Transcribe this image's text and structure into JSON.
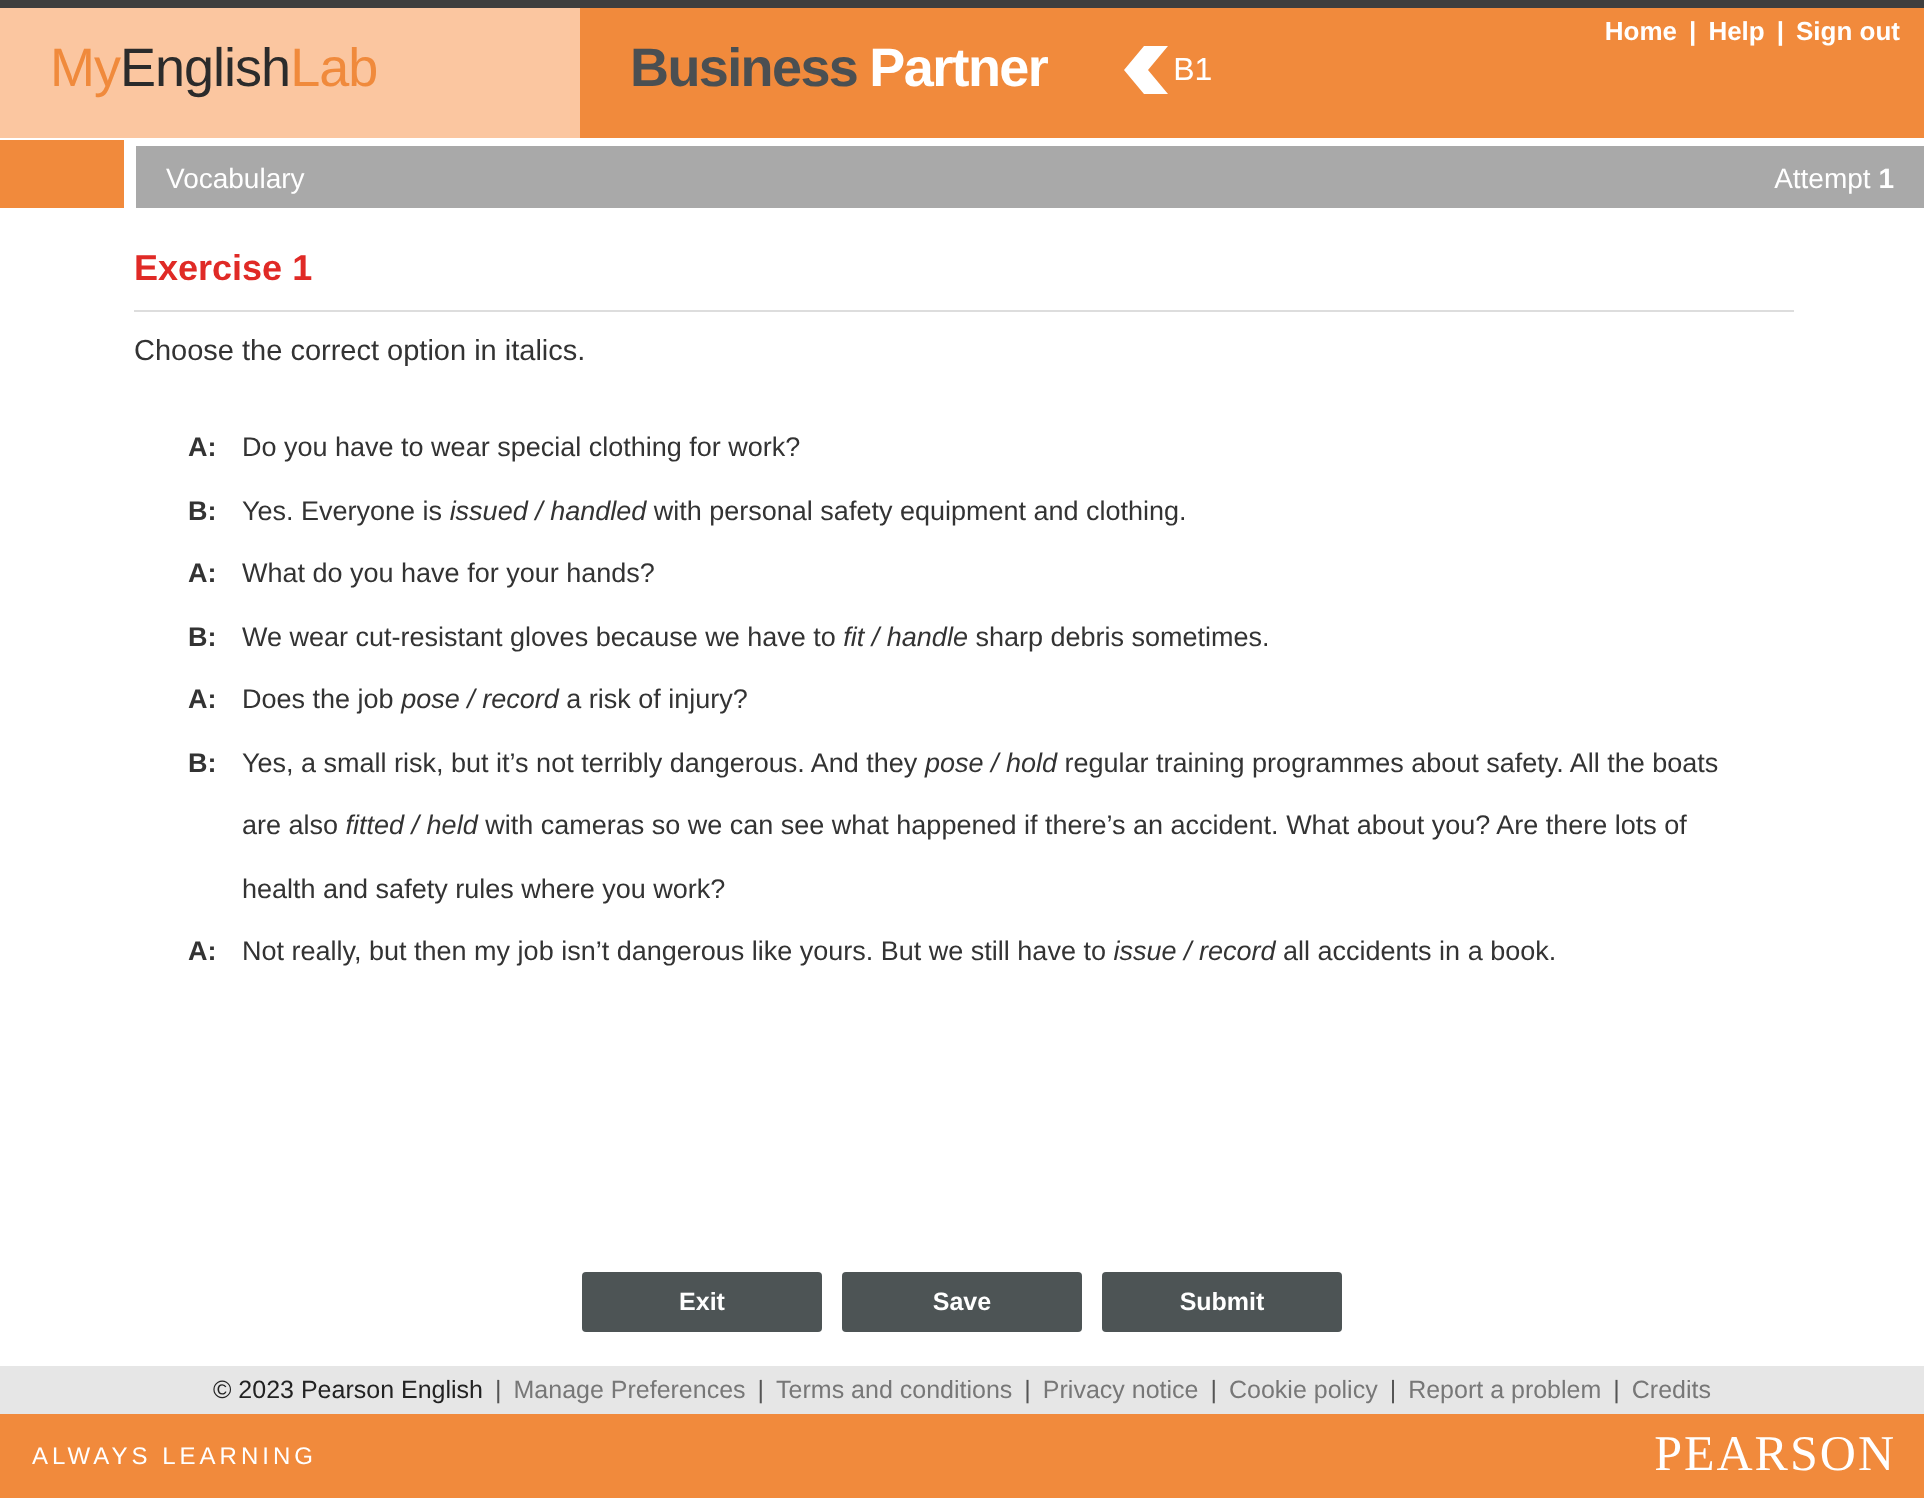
{
  "header": {
    "logo": [
      {
        "text": "My",
        "color": "#f08a3c"
      },
      {
        "text": "English",
        "color": "#2b2b2b"
      },
      {
        "text": "Lab",
        "color": "#f08a3c"
      }
    ],
    "brand": [
      {
        "text": "Business",
        "color": "#4a4f52"
      },
      {
        "text": "Partner",
        "color": "#ffffff"
      }
    ],
    "level": "B1",
    "nav": [
      "Home",
      "Help",
      "Sign out"
    ],
    "separator": "|"
  },
  "subbar": {
    "title": "Vocabulary",
    "attempt_label": "Attempt",
    "attempt": "1"
  },
  "exercise": {
    "title": "Exercise 1",
    "instruction": "Choose the correct option in italics.",
    "lines": [
      {
        "speaker": "A:",
        "text": "Do you have to wear special clothing for work?"
      },
      {
        "speaker": "B:",
        "text": "Yes. Everyone is *issued /  handled* with personal safety equipment and clothing."
      },
      {
        "speaker": "A:",
        "text": "What do you have for your hands?"
      },
      {
        "speaker": "B:",
        "text": "We wear cut-resistant gloves because we have to *fit / handle* sharp debris sometimes."
      },
      {
        "speaker": "A:",
        "text": "Does the job *pose / record* a risk of injury?"
      },
      {
        "speaker": "B:",
        "text": "Yes, a small risk, but it’s not terribly dangerous. And they *pose / hold* regular training programmes about safety. All the boats are also *fitted / held* with cameras so we can see what happened if there’s an accident. What about you? Are there lots of health and safety rules where you work?"
      },
      {
        "speaker": "A:",
        "text": "Not really, but then my job isn’t dangerous like yours. But we still have to *issue / record* all accidents in a book."
      }
    ]
  },
  "buttons": [
    "Exit",
    "Save",
    "Submit"
  ],
  "footer": {
    "copyright": "© 2023 Pearson English",
    "links": [
      "Manage Preferences",
      "Terms and conditions",
      "Privacy notice",
      "Cookie policy",
      "Report a problem",
      "Credits"
    ],
    "separator": "|",
    "tagline": "ALWAYS LEARNING",
    "brand": "PEARSON"
  }
}
